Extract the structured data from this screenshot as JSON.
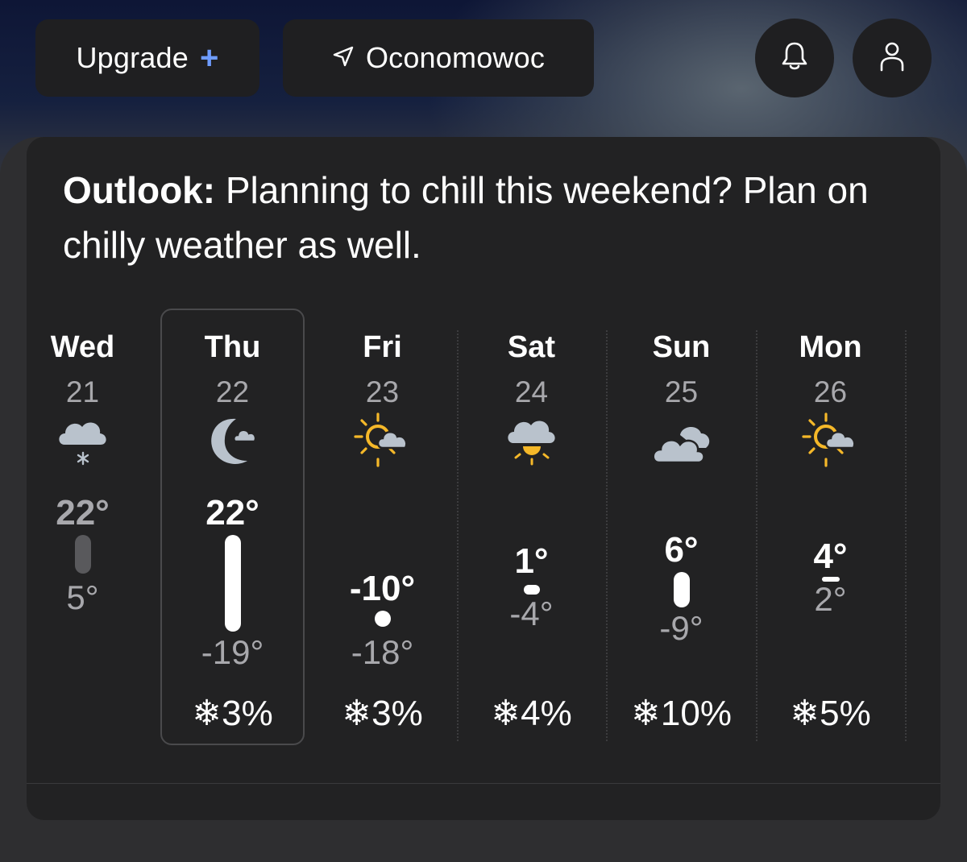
{
  "header": {
    "upgrade_label": "Upgrade",
    "upgrade_plus": "+",
    "location_label": "Oconomowoc"
  },
  "outlook": {
    "label": "Outlook:",
    "text": " Planning to chill this weekend? Plan on chilly weather as well."
  },
  "days": [
    {
      "name": "Wed",
      "date": "21",
      "icon": "snow-cloud-icon",
      "high": "22°",
      "low": "5°",
      "precip": ""
    },
    {
      "name": "Thu",
      "date": "22",
      "icon": "partly-cloudy-night-icon",
      "high": "22°",
      "low": "-19°",
      "precip": "3%"
    },
    {
      "name": "Fri",
      "date": "23",
      "icon": "partly-sunny-icon",
      "high": "-10°",
      "low": "-18°",
      "precip": "3%"
    },
    {
      "name": "Sat",
      "date": "24",
      "icon": "cloud-sun-icon",
      "high": "1°",
      "low": "-4°",
      "precip": "4%"
    },
    {
      "name": "Sun",
      "date": "25",
      "icon": "cloudy-icon",
      "high": "6°",
      "low": "-9°",
      "precip": "10%"
    },
    {
      "name": "Mon",
      "date": "26",
      "icon": "partly-sunny-icon",
      "high": "4°",
      "low": "2°",
      "precip": "5%"
    }
  ],
  "colors": {
    "accent_plus": "#6e9cff",
    "sun": "#f5b829",
    "cloud": "#b9c2cc",
    "moon": "#b9c2cc",
    "card": "#222223"
  }
}
